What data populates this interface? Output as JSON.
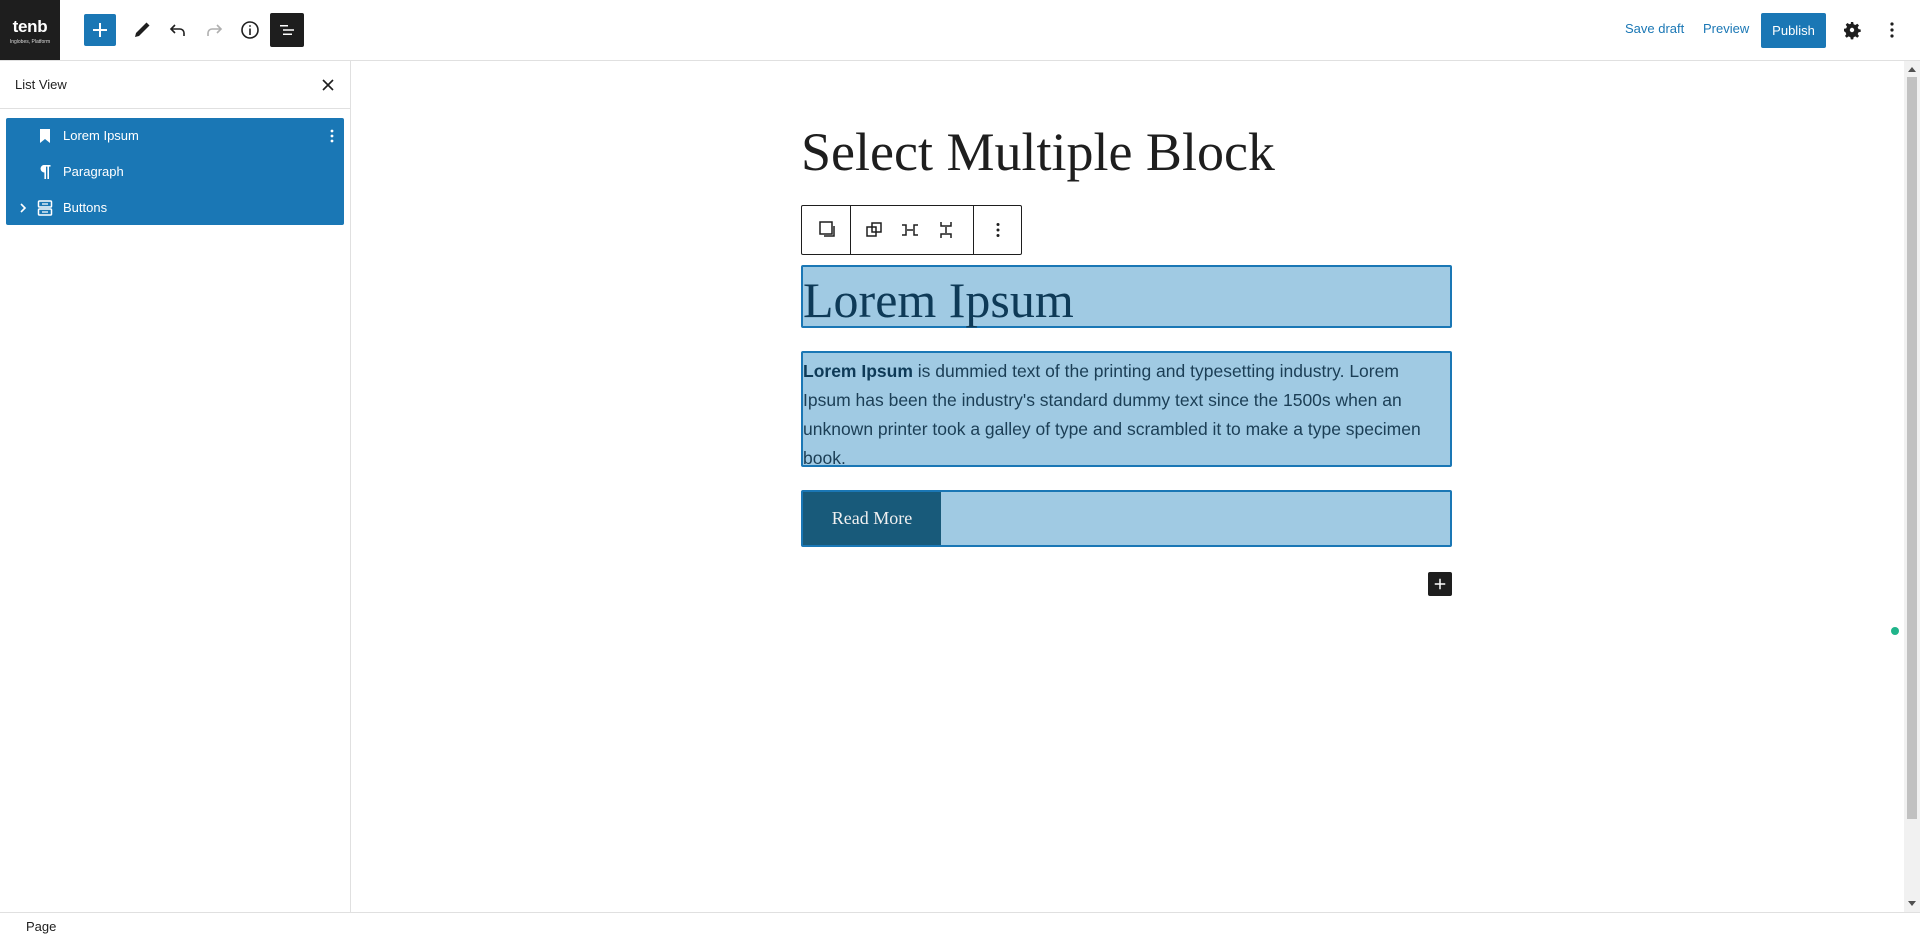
{
  "header": {
    "site_logo_title": "tenb",
    "site_logo_subtitle": "Inglobes, Platform",
    "save_draft": "Save draft",
    "preview": "Preview",
    "publish": "Publish"
  },
  "list_view": {
    "title": "List View",
    "items": [
      {
        "label": "Lorem Ipsum",
        "icon": "bookmark-icon"
      },
      {
        "label": "Paragraph",
        "icon": "pilcrow-icon"
      },
      {
        "label": "Buttons",
        "icon": "buttons-icon"
      }
    ]
  },
  "editor": {
    "page_title": "Select Multiple Block",
    "heading": "Lorem Ipsum",
    "paragraph_bold": "Lorem Ipsum",
    "paragraph_rest": " is dummied text of the printing and typesetting industry. Lorem Ipsum has been the industry's standard dummy text since the 1500s when an unknown printer took a galley of type and scrambled it to make a type specimen book.",
    "button_label": "Read More"
  },
  "footer": {
    "breadcrumb": "Page"
  },
  "colors": {
    "accent": "#1a77b5",
    "selection": "#a0cae3",
    "button_bg": "#185a7a",
    "dark": "#1e1e1e"
  }
}
